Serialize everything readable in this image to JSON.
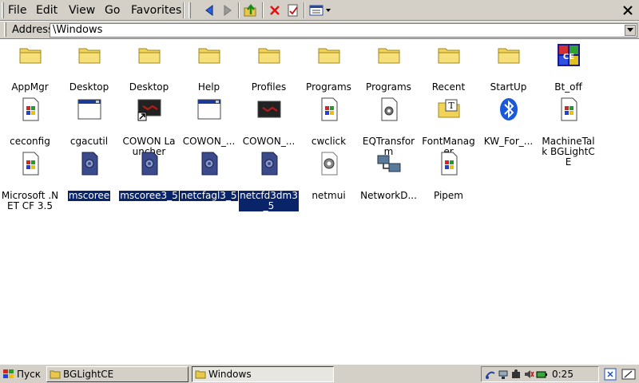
{
  "menubar": {
    "items": [
      "File",
      "Edit",
      "View",
      "Go",
      "Favorites"
    ],
    "toolbar_icons": [
      "back-icon",
      "forward-icon",
      "up-folder-icon",
      "delete-icon",
      "properties-icon",
      "view-menu-icon"
    ],
    "close_icon": "close-icon"
  },
  "address": {
    "label": "Address",
    "path": "\\Windows"
  },
  "items": [
    {
      "label": "AppMgr",
      "icon": "folder-icon",
      "selected": false
    },
    {
      "label": "Desktop",
      "icon": "folder-icon",
      "selected": false
    },
    {
      "label": "Desktop",
      "icon": "folder-icon",
      "selected": false
    },
    {
      "label": "Help",
      "icon": "folder-icon",
      "selected": false
    },
    {
      "label": "Profiles",
      "icon": "folder-icon",
      "selected": false
    },
    {
      "label": "Programs",
      "icon": "folder-icon",
      "selected": false
    },
    {
      "label": "Programs",
      "icon": "folder-icon",
      "selected": false
    },
    {
      "label": "Recent",
      "icon": "folder-icon",
      "selected": false
    },
    {
      "label": "StartUp",
      "icon": "folder-icon",
      "selected": false
    },
    {
      "label": "Bt_off",
      "icon": "ce-app-icon",
      "selected": false
    },
    {
      "label": "ceconfig",
      "icon": "windows-file-icon",
      "selected": false
    },
    {
      "label": "cgacutil",
      "icon": "window-app-icon",
      "selected": false
    },
    {
      "label": "COWON Launcher",
      "icon": "cowon-shortcut-icon",
      "selected": false
    },
    {
      "label": "COWON_...",
      "icon": "window-app-icon",
      "selected": false
    },
    {
      "label": "COWON_...",
      "icon": "cowon-app-icon",
      "selected": false
    },
    {
      "label": "cwclick",
      "icon": "windows-file-icon",
      "selected": false
    },
    {
      "label": "EQTransform",
      "icon": "gear-file-icon",
      "selected": false
    },
    {
      "label": "FontManager",
      "icon": "font-folder-icon",
      "selected": false
    },
    {
      "label": "KW_For_...",
      "icon": "bluetooth-icon",
      "selected": false
    },
    {
      "label": "MachineTalk BGLightCE",
      "icon": "windows-file-icon",
      "selected": false
    },
    {
      "label": "Microsoft .NET CF 3.5",
      "icon": "windows-file-icon",
      "selected": false
    },
    {
      "label": "mscoree",
      "icon": "dll-file-icon",
      "selected": true
    },
    {
      "label": "mscoree3_5",
      "icon": "dll-file-icon",
      "selected": true
    },
    {
      "label": "netcfagl3_5",
      "icon": "dll-file-icon",
      "selected": true
    },
    {
      "label": "netcfd3dm3_5",
      "icon": "dll-file-icon",
      "selected": true
    },
    {
      "label": "netmui",
      "icon": "gear-icon",
      "selected": false
    },
    {
      "label": "NetworkD...",
      "icon": "network-icon",
      "selected": false
    },
    {
      "label": "Pipem",
      "icon": "windows-file-icon",
      "selected": false
    }
  ],
  "taskbar": {
    "start_label": "Пуск",
    "tasks": [
      {
        "label": "BGLightCE",
        "active": false
      },
      {
        "label": "Windows",
        "active": true
      }
    ],
    "clock": "0:25",
    "tray_icons": [
      "usb-icon",
      "network-tray-icon",
      "audio-icon",
      "mute-icon",
      "battery-icon"
    ],
    "right_icons": [
      "desktop-icon",
      "input-panel-icon"
    ]
  }
}
